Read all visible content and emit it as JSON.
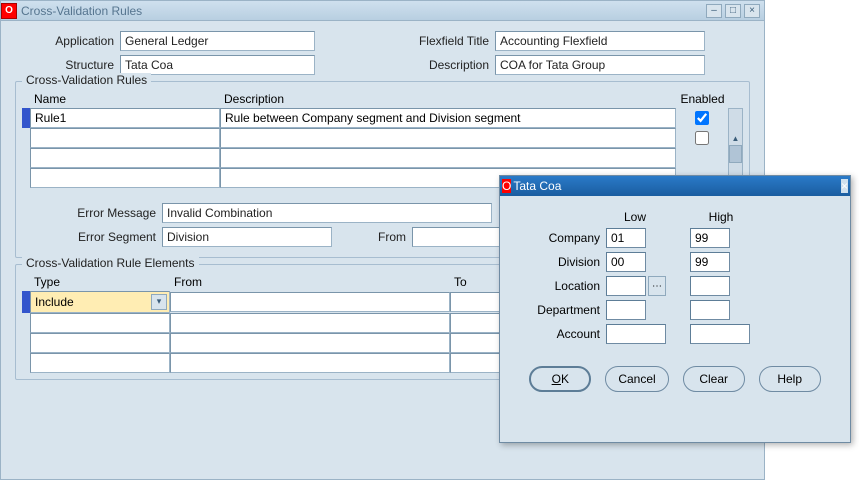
{
  "main": {
    "title": "Cross-Validation Rules",
    "header": {
      "application_label": "Application",
      "application_value": "General Ledger",
      "structure_label": "Structure",
      "structure_value": "Tata Coa",
      "flexfield_title_label": "Flexfield Title",
      "flexfield_title_value": "Accounting Flexfield",
      "description_label": "Description",
      "description_value": "COA for Tata Group"
    },
    "rules": {
      "group_label": "Cross-Validation Rules",
      "col_name": "Name",
      "col_description": "Description",
      "col_enabled": "Enabled",
      "rows": [
        {
          "name": "Rule1",
          "description": "Rule between Company segment and Division segment",
          "enabled": true
        },
        {
          "name": "",
          "description": "",
          "enabled": false
        },
        {
          "name": "",
          "description": "",
          "enabled": false
        },
        {
          "name": "",
          "description": "",
          "enabled": false
        }
      ],
      "error_message_label": "Error Message",
      "error_message_value": "Invalid Combination",
      "error_segment_label": "Error Segment",
      "error_segment_value": "Division",
      "from_label": "From"
    },
    "elements": {
      "group_label": "Cross-Validation Rule Elements",
      "col_type": "Type",
      "col_from": "From",
      "col_to": "To",
      "rows": [
        {
          "type": "Include",
          "from": "",
          "to": ""
        },
        {
          "type": "",
          "from": "",
          "to": ""
        },
        {
          "type": "",
          "from": "",
          "to": ""
        },
        {
          "type": "",
          "from": "",
          "to": ""
        }
      ]
    }
  },
  "dialog": {
    "title": "Tata Coa",
    "col_low": "Low",
    "col_high": "High",
    "rows": {
      "company": {
        "label": "Company",
        "low": "01",
        "high": "99"
      },
      "division": {
        "label": "Division",
        "low": "00",
        "high": "99"
      },
      "location": {
        "label": "Location",
        "low": "",
        "high": ""
      },
      "department": {
        "label": "Department",
        "low": "",
        "high": ""
      },
      "account": {
        "label": "Account",
        "low": "",
        "high": ""
      }
    },
    "buttons": {
      "ok": "OK",
      "cancel": "Cancel",
      "clear": "Clear",
      "help": "Help"
    }
  }
}
